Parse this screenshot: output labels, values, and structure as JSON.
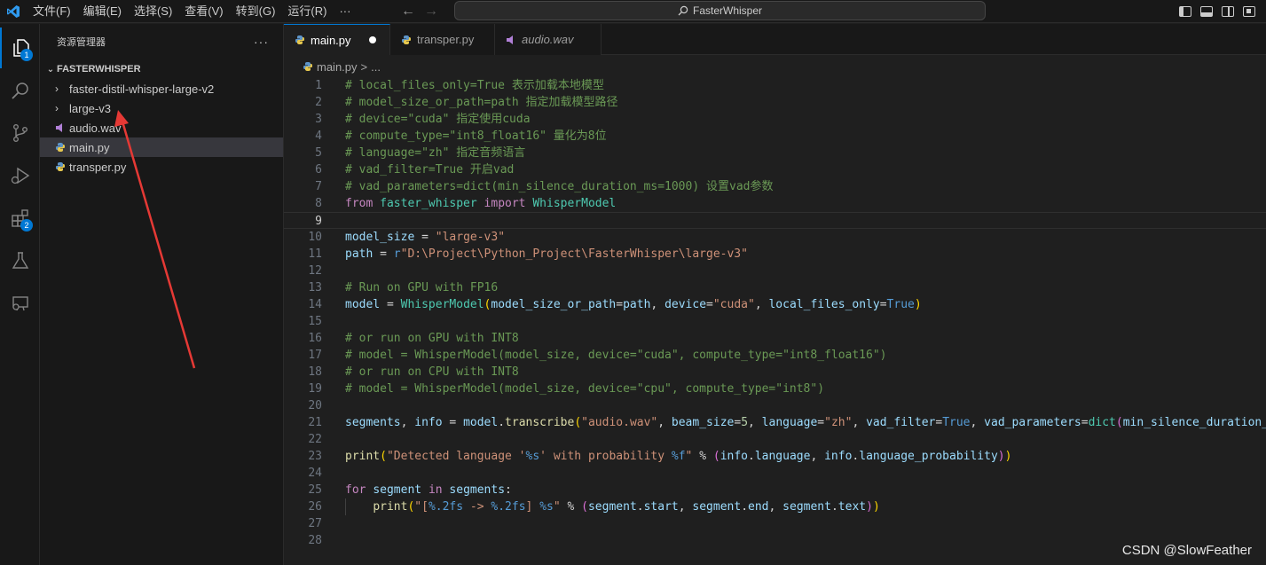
{
  "titlebar": {
    "menu": [
      "文件(F)",
      "编辑(E)",
      "选择(S)",
      "查看(V)",
      "转到(G)",
      "运行(R)",
      "···"
    ],
    "search_text": "FasterWhisper",
    "back_icon": "arrow-left-icon",
    "forward_icon": "arrow-right-icon"
  },
  "activitybar": {
    "items": [
      {
        "icon": "explorer-icon",
        "badge": "1"
      },
      {
        "icon": "search-icon"
      },
      {
        "icon": "source-control-icon"
      },
      {
        "icon": "run-debug-icon"
      },
      {
        "icon": "extensions-icon",
        "badge": "2"
      },
      {
        "icon": "testing-icon"
      },
      {
        "icon": "remote-explorer-icon"
      }
    ]
  },
  "sidebar": {
    "title": "资源管理器",
    "more": "···",
    "folder": "FASTERWHISPER",
    "items": [
      {
        "label": "faster-distil-whisper-large-v2",
        "type": "folder"
      },
      {
        "label": "large-v3",
        "type": "folder"
      },
      {
        "label": "audio.wav",
        "type": "audio"
      },
      {
        "label": "main.py",
        "type": "python"
      },
      {
        "label": "transper.py",
        "type": "python"
      }
    ]
  },
  "tabs": [
    {
      "label": "main.py",
      "active": true,
      "modified": true
    },
    {
      "label": "transper.py",
      "active": false
    },
    {
      "label": "audio.wav",
      "active": false,
      "italic": true
    }
  ],
  "breadcrumb": {
    "file": "main.py",
    "sep": ">",
    "rest": "..."
  },
  "editor": {
    "current_line": 9,
    "lines": [
      {
        "n": "1",
        "tokens": [
          [
            "c-comment",
            "# local_files_only=True 表示加载本地模型"
          ]
        ]
      },
      {
        "n": "2",
        "tokens": [
          [
            "c-comment",
            "# model_size_or_path=path 指定加载模型路径"
          ]
        ]
      },
      {
        "n": "3",
        "tokens": [
          [
            "c-comment",
            "# device=\"cuda\" 指定使用cuda"
          ]
        ]
      },
      {
        "n": "4",
        "tokens": [
          [
            "c-comment",
            "# compute_type=\"int8_float16\" 量化为8位"
          ]
        ]
      },
      {
        "n": "5",
        "tokens": [
          [
            "c-comment",
            "# language=\"zh\" 指定音频语言"
          ]
        ]
      },
      {
        "n": "6",
        "tokens": [
          [
            "c-comment",
            "# vad_filter=True 开启vad"
          ]
        ]
      },
      {
        "n": "7",
        "tokens": [
          [
            "c-comment",
            "# vad_parameters=dict(min_silence_duration_ms=1000) 设置vad参数"
          ]
        ]
      },
      {
        "n": "8",
        "tokens": [
          [
            "c-kw",
            "from"
          ],
          [
            "c-plain",
            " "
          ],
          [
            "c-cls",
            "faster_whisper"
          ],
          [
            "c-plain",
            " "
          ],
          [
            "c-kw",
            "import"
          ],
          [
            "c-plain",
            " "
          ],
          [
            "c-cls",
            "WhisperModel"
          ]
        ]
      },
      {
        "n": "9",
        "tokens": []
      },
      {
        "n": "10",
        "tokens": [
          [
            "c-var",
            "model_size"
          ],
          [
            "c-plain",
            " = "
          ],
          [
            "c-str",
            "\"large-v3\""
          ]
        ]
      },
      {
        "n": "11",
        "tokens": [
          [
            "c-var",
            "path"
          ],
          [
            "c-plain",
            " = "
          ],
          [
            "c-kw2",
            "r"
          ],
          [
            "c-str",
            "\"D:\\Project\\Python_Project\\FasterWhisper\\large-v3\""
          ]
        ]
      },
      {
        "n": "12",
        "tokens": []
      },
      {
        "n": "13",
        "tokens": [
          [
            "c-comment",
            "# Run on GPU with FP16"
          ]
        ]
      },
      {
        "n": "14",
        "tokens": [
          [
            "c-var",
            "model"
          ],
          [
            "c-plain",
            " = "
          ],
          [
            "c-cls",
            "WhisperModel"
          ],
          [
            "c-paren",
            "("
          ],
          [
            "c-var",
            "model_size_or_path"
          ],
          [
            "c-plain",
            "="
          ],
          [
            "c-var",
            "path"
          ],
          [
            "c-plain",
            ", "
          ],
          [
            "c-var",
            "device"
          ],
          [
            "c-plain",
            "="
          ],
          [
            "c-str",
            "\"cuda\""
          ],
          [
            "c-plain",
            ", "
          ],
          [
            "c-var",
            "local_files_only"
          ],
          [
            "c-plain",
            "="
          ],
          [
            "c-kw2",
            "True"
          ],
          [
            "c-paren",
            ")"
          ]
        ]
      },
      {
        "n": "15",
        "tokens": []
      },
      {
        "n": "16",
        "tokens": [
          [
            "c-comment",
            "# or run on GPU with INT8"
          ]
        ]
      },
      {
        "n": "17",
        "tokens": [
          [
            "c-comment",
            "# model = WhisperModel(model_size, device=\"cuda\", compute_type=\"int8_float16\")"
          ]
        ]
      },
      {
        "n": "18",
        "tokens": [
          [
            "c-comment",
            "# or run on CPU with INT8"
          ]
        ]
      },
      {
        "n": "19",
        "tokens": [
          [
            "c-comment",
            "# model = WhisperModel(model_size, device=\"cpu\", compute_type=\"int8\")"
          ]
        ]
      },
      {
        "n": "20",
        "tokens": []
      },
      {
        "n": "21",
        "tokens": [
          [
            "c-var",
            "segments"
          ],
          [
            "c-plain",
            ", "
          ],
          [
            "c-var",
            "info"
          ],
          [
            "c-plain",
            " = "
          ],
          [
            "c-var",
            "model"
          ],
          [
            "c-plain",
            "."
          ],
          [
            "c-fn",
            "transcribe"
          ],
          [
            "c-paren",
            "("
          ],
          [
            "c-str",
            "\"audio.wav\""
          ],
          [
            "c-plain",
            ", "
          ],
          [
            "c-var",
            "beam_size"
          ],
          [
            "c-plain",
            "="
          ],
          [
            "c-num",
            "5"
          ],
          [
            "c-plain",
            ", "
          ],
          [
            "c-var",
            "language"
          ],
          [
            "c-plain",
            "="
          ],
          [
            "c-str",
            "\"zh\""
          ],
          [
            "c-plain",
            ", "
          ],
          [
            "c-var",
            "vad_filter"
          ],
          [
            "c-plain",
            "="
          ],
          [
            "c-kw2",
            "True"
          ],
          [
            "c-plain",
            ", "
          ],
          [
            "c-var",
            "vad_parameters"
          ],
          [
            "c-plain",
            "="
          ],
          [
            "c-cls",
            "dict"
          ],
          [
            "c-paren2",
            "("
          ],
          [
            "c-var",
            "min_silence_duration_ms"
          ]
        ]
      },
      {
        "n": "22",
        "tokens": []
      },
      {
        "n": "23",
        "tokens": [
          [
            "c-fn",
            "print"
          ],
          [
            "c-paren",
            "("
          ],
          [
            "c-str",
            "\"Detected language '"
          ],
          [
            "c-fmt",
            "%s"
          ],
          [
            "c-str",
            "' with probability "
          ],
          [
            "c-fmt",
            "%f"
          ],
          [
            "c-str",
            "\""
          ],
          [
            "c-plain",
            " % "
          ],
          [
            "c-paren2",
            "("
          ],
          [
            "c-var",
            "info"
          ],
          [
            "c-plain",
            "."
          ],
          [
            "c-var",
            "language"
          ],
          [
            "c-plain",
            ", "
          ],
          [
            "c-var",
            "info"
          ],
          [
            "c-plain",
            "."
          ],
          [
            "c-var",
            "language_probability"
          ],
          [
            "c-paren2",
            ")"
          ],
          [
            "c-paren",
            ")"
          ]
        ]
      },
      {
        "n": "24",
        "tokens": []
      },
      {
        "n": "25",
        "tokens": [
          [
            "c-kw",
            "for"
          ],
          [
            "c-plain",
            " "
          ],
          [
            "c-var",
            "segment"
          ],
          [
            "c-plain",
            " "
          ],
          [
            "c-kw",
            "in"
          ],
          [
            "c-plain",
            " "
          ],
          [
            "c-var",
            "segments"
          ],
          [
            "c-plain",
            ":"
          ]
        ]
      },
      {
        "n": "26",
        "tokens": [
          [
            "c-plain",
            "    "
          ],
          [
            "c-fn",
            "print"
          ],
          [
            "c-paren",
            "("
          ],
          [
            "c-str",
            "\"["
          ],
          [
            "c-fmt",
            "%.2fs"
          ],
          [
            "c-str",
            " -> "
          ],
          [
            "c-fmt",
            "%.2fs"
          ],
          [
            "c-str",
            "] "
          ],
          [
            "c-fmt",
            "%s"
          ],
          [
            "c-str",
            "\""
          ],
          [
            "c-plain",
            " % "
          ],
          [
            "c-paren2",
            "("
          ],
          [
            "c-var",
            "segment"
          ],
          [
            "c-plain",
            "."
          ],
          [
            "c-var",
            "start"
          ],
          [
            "c-plain",
            ", "
          ],
          [
            "c-var",
            "segment"
          ],
          [
            "c-plain",
            "."
          ],
          [
            "c-var",
            "end"
          ],
          [
            "c-plain",
            ", "
          ],
          [
            "c-var",
            "segment"
          ],
          [
            "c-plain",
            "."
          ],
          [
            "c-var",
            "text"
          ],
          [
            "c-paren2",
            ")"
          ],
          [
            "c-paren",
            ")"
          ]
        ]
      },
      {
        "n": "27",
        "tokens": []
      },
      {
        "n": "28",
        "tokens": []
      }
    ]
  },
  "watermark": "CSDN @SlowFeather",
  "colors": {
    "accent": "#0078d4",
    "annotation_arrow": "#e53935"
  }
}
